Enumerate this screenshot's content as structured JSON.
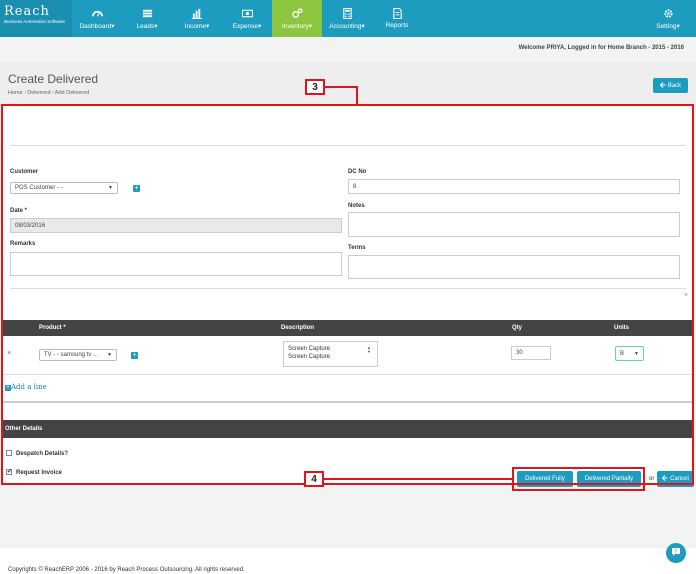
{
  "nav": {
    "brand": "Reach",
    "tagline": "Business Automation Software",
    "items": [
      {
        "label": "Dashboard",
        "icon": "speedometer-icon"
      },
      {
        "label": "Leads",
        "icon": "leads-icon"
      },
      {
        "label": "Income",
        "icon": "bar-chart-icon"
      },
      {
        "label": "Expense",
        "icon": "money-icon"
      },
      {
        "label": "Inventory",
        "icon": "gears-icon"
      },
      {
        "label": "Accounting",
        "icon": "calculator-icon"
      },
      {
        "label": "Reports",
        "icon": "document-icon"
      }
    ],
    "setting": "Setting",
    "active_color": "#8cc63f",
    "bar_color": "#1e9cbf"
  },
  "welcome": "Welcome PRIYA, Logged in for Home Branch - 2015 - 2016",
  "page": {
    "title": "Create Delivered",
    "breadcrumb": [
      "Home",
      "Delivered",
      "Add Delivered"
    ],
    "back": "Back"
  },
  "form": {
    "customer_label": "Customer",
    "customer_value": "POS Customer - -",
    "date_label": "Date *",
    "date_value": "08/03/2016",
    "remarks_label": "Remarks",
    "dcno_label": "DC No",
    "dcno_value": "8",
    "notes_label": "Notes",
    "terms_label": "Terms"
  },
  "table": {
    "columns": [
      "Product *",
      "Description",
      "Qty",
      "Units"
    ],
    "row": {
      "remove": "×",
      "product": "TV - - samsung tv ...",
      "description_lines": [
        "Screen Capture",
        "Screen Capture"
      ],
      "qty": "30",
      "units": "B"
    },
    "add_line": "Add a line"
  },
  "other": {
    "header": "Other Details",
    "despatch": "Despatch Details?",
    "request_invoice": "Request Invoice"
  },
  "actions": {
    "delivered_fully": "Delivered Fully",
    "delivered_partially": "Delivered Partially",
    "or": "or",
    "cancel": "Cancel"
  },
  "callouts": {
    "form": "3",
    "buttons": "4"
  },
  "footer": "Copyrights © ReachERP 2006 - 2016 by Reach Process Outsourcing. All rights reserved.",
  "annotation_color": "#e0151b"
}
